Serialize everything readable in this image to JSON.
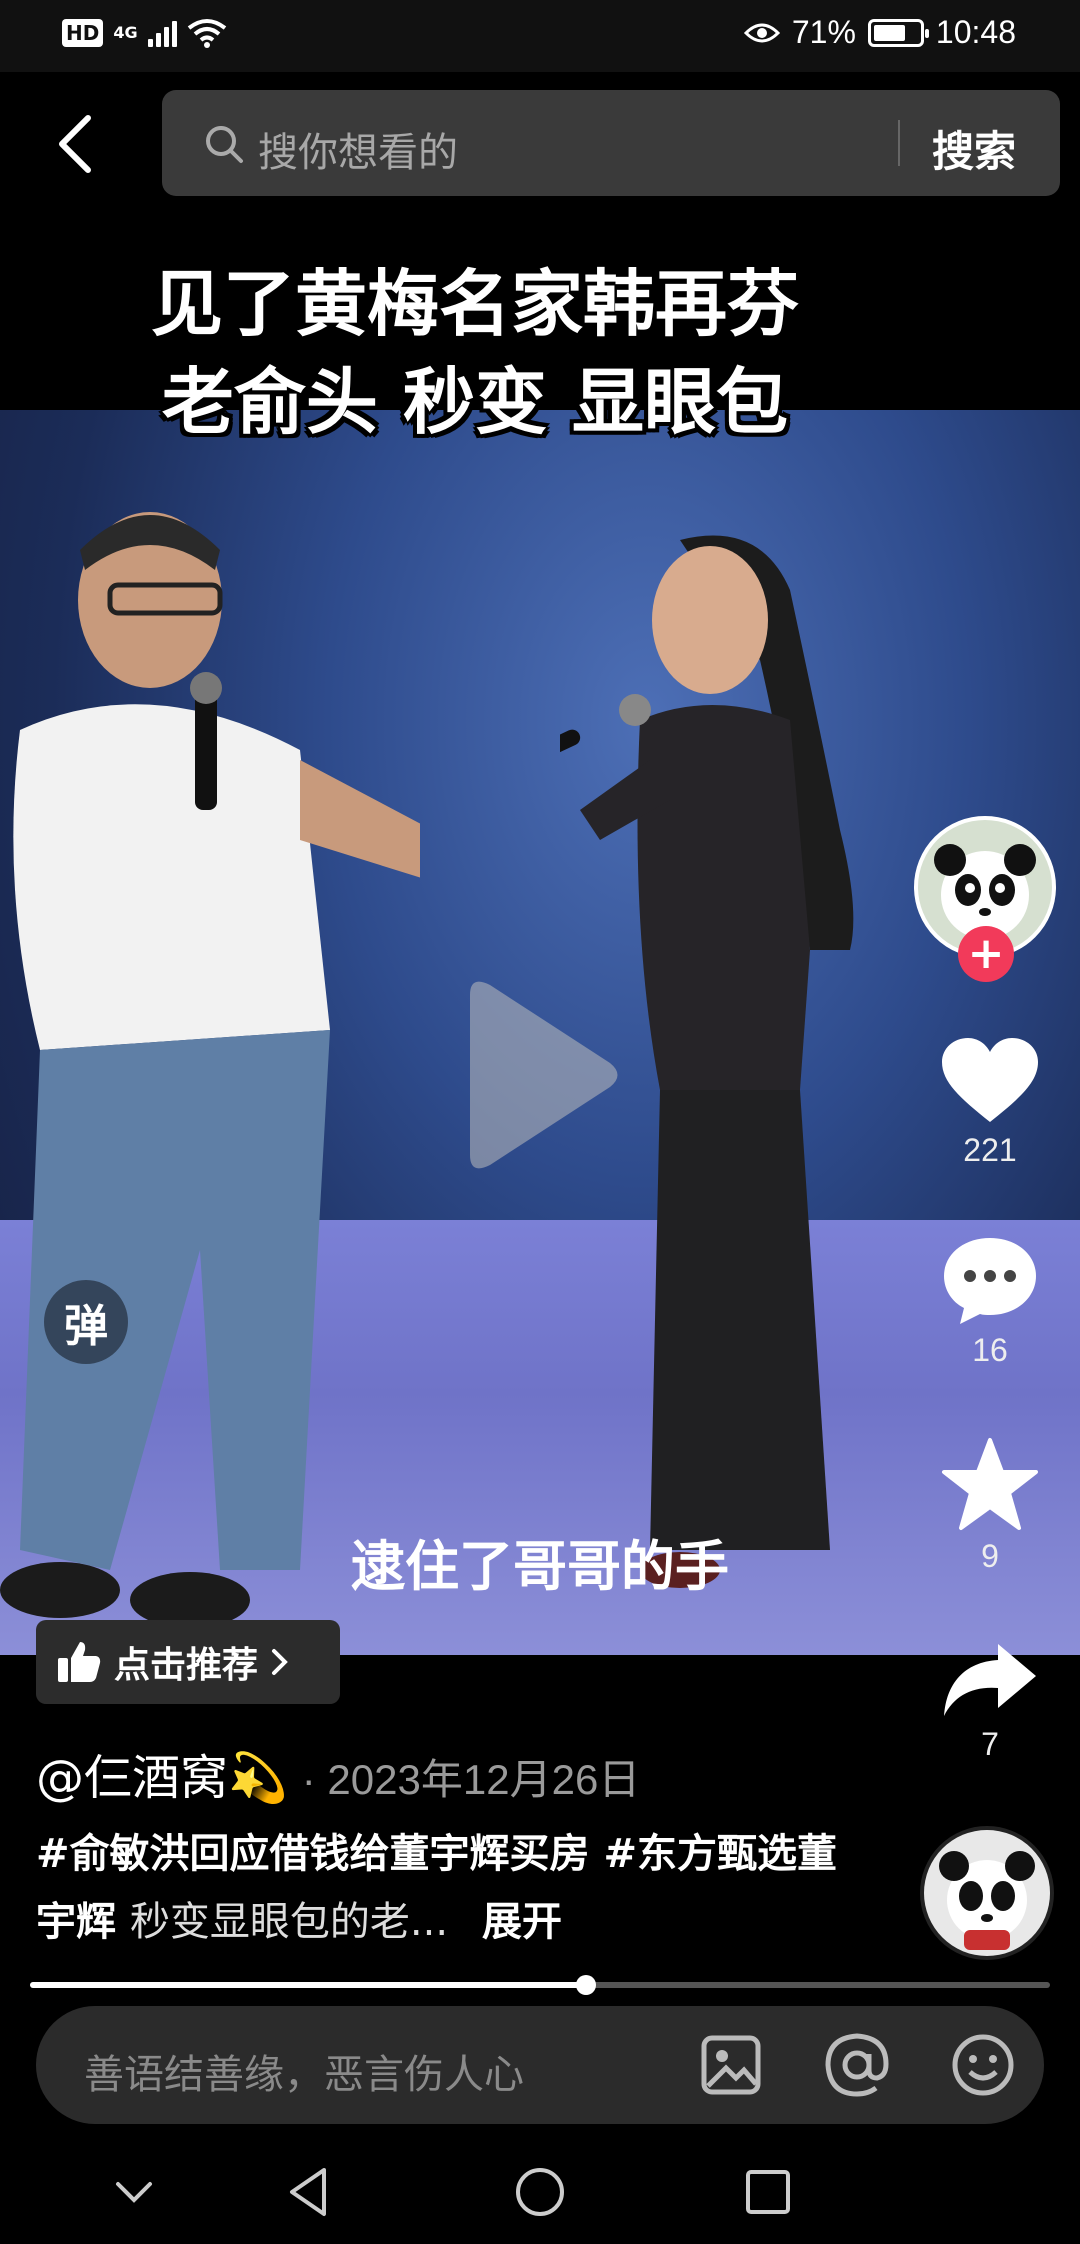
{
  "status_bar": {
    "hd": "HD",
    "network": "4G",
    "battery_percent": "71%",
    "battery_level": 0.71,
    "time": "10:48"
  },
  "search": {
    "placeholder": "搜你想看的",
    "button_label": "搜索"
  },
  "video": {
    "title_line1": "见了黄梅名家韩再芬",
    "title_line2": "老俞头 秒变 显眼包",
    "subtitle": "逮住了哥哥的手",
    "danmaku_label": "弹"
  },
  "sidebar": {
    "likes": "221",
    "comments": "16",
    "favorites": "9",
    "shares": "7",
    "follow_symbol": "+"
  },
  "recommend": {
    "label": "点击推荐"
  },
  "post": {
    "author": "@仨酒窝💫",
    "date": "· 2023年12月26日",
    "hashtag1": "#俞敏洪回应借钱给董宇辉买房",
    "hashtag2": "#东方甄选董宇辉",
    "text": "秒变显眼包的老...",
    "more_label": "展开"
  },
  "progress": {
    "fraction": 0.545
  },
  "comment_bar": {
    "placeholder": "善语结善缘，恶言伤人心"
  },
  "colors": {
    "follow_red": "#f23a5a",
    "search_bg": "#3a3a3a",
    "comment_bg": "#2b2b2b"
  },
  "icons": [
    "back-arrow-icon",
    "search-icon",
    "play-icon",
    "heart-icon",
    "comment-bubble-icon",
    "star-icon",
    "share-arrow-icon",
    "thumbs-up-icon",
    "chevron-right-icon",
    "image-icon",
    "at-icon",
    "emoji-icon",
    "nav-down-icon",
    "nav-back-icon",
    "nav-home-icon",
    "nav-recents-icon"
  ]
}
